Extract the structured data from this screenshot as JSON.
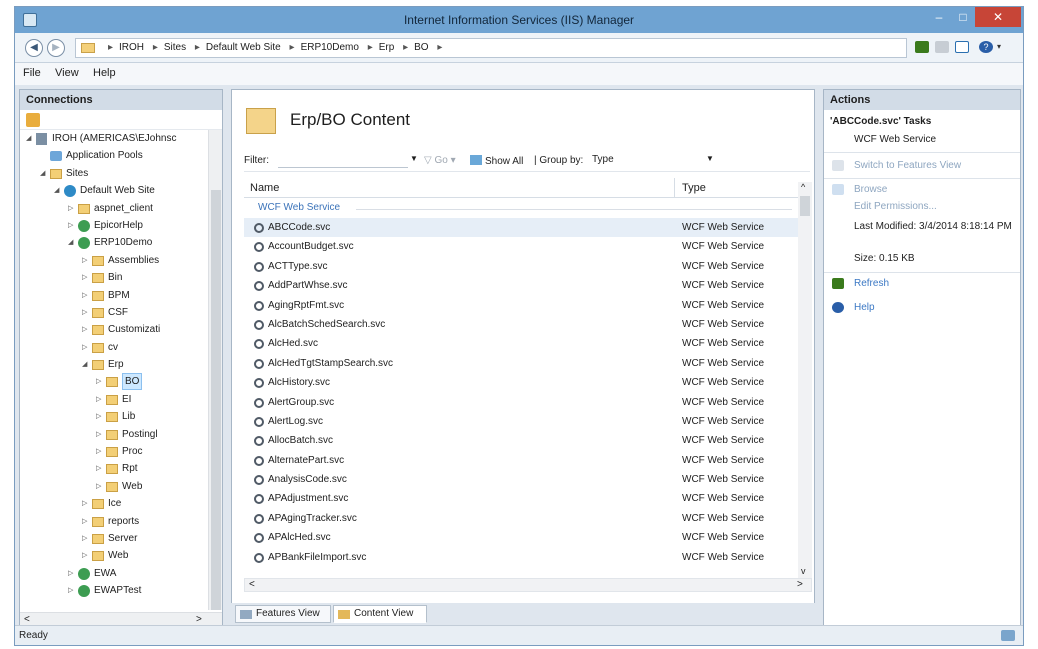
{
  "window": {
    "title": "Internet Information Services (IIS) Manager",
    "min": "–",
    "max": "□",
    "close": "✕"
  },
  "breadcrumb": {
    "items": [
      "IROH",
      "Sites",
      "Default Web Site",
      "ERP10Demo",
      "Erp",
      "BO"
    ]
  },
  "menu": {
    "file": "File",
    "view": "View",
    "help": "Help"
  },
  "connections": {
    "title": "Connections",
    "tree": [
      {
        "label": "IROH (AMERICAS\\EJohnsc",
        "depth": 0,
        "icon": "server",
        "expander": "◢"
      },
      {
        "label": "Application Pools",
        "depth": 1,
        "icon": "pool",
        "expander": ""
      },
      {
        "label": "Sites",
        "depth": 1,
        "icon": "folder",
        "expander": "◢"
      },
      {
        "label": "Default Web Site",
        "depth": 2,
        "icon": "globe",
        "expander": "◢"
      },
      {
        "label": "aspnet_client",
        "depth": 3,
        "icon": "folder",
        "expander": "▷"
      },
      {
        "label": "EpicorHelp",
        "depth": 3,
        "icon": "app",
        "expander": "▷"
      },
      {
        "label": "ERP10Demo",
        "depth": 3,
        "icon": "app",
        "expander": "◢"
      },
      {
        "label": "Assemblies",
        "depth": 4,
        "icon": "folder",
        "expander": "▷"
      },
      {
        "label": "Bin",
        "depth": 4,
        "icon": "folder",
        "expander": "▷"
      },
      {
        "label": "BPM",
        "depth": 4,
        "icon": "folder",
        "expander": "▷"
      },
      {
        "label": "CSF",
        "depth": 4,
        "icon": "folder",
        "expander": "▷"
      },
      {
        "label": "Customizati",
        "depth": 4,
        "icon": "folder",
        "expander": "▷"
      },
      {
        "label": "cv",
        "depth": 4,
        "icon": "folder",
        "expander": "▷"
      },
      {
        "label": "Erp",
        "depth": 4,
        "icon": "folder",
        "expander": "◢"
      },
      {
        "label": "BO",
        "depth": 5,
        "icon": "folder",
        "expander": "▷",
        "selected": true
      },
      {
        "label": "EI",
        "depth": 5,
        "icon": "folder",
        "expander": "▷"
      },
      {
        "label": "Lib",
        "depth": 5,
        "icon": "folder",
        "expander": "▷"
      },
      {
        "label": "Postingl",
        "depth": 5,
        "icon": "folder",
        "expander": "▷"
      },
      {
        "label": "Proc",
        "depth": 5,
        "icon": "folder",
        "expander": "▷"
      },
      {
        "label": "Rpt",
        "depth": 5,
        "icon": "folder",
        "expander": "▷"
      },
      {
        "label": "Web",
        "depth": 5,
        "icon": "folder",
        "expander": "▷"
      },
      {
        "label": "Ice",
        "depth": 4,
        "icon": "folder",
        "expander": "▷"
      },
      {
        "label": "reports",
        "depth": 4,
        "icon": "folder",
        "expander": "▷"
      },
      {
        "label": "Server",
        "depth": 4,
        "icon": "folder",
        "expander": "▷"
      },
      {
        "label": "Web",
        "depth": 4,
        "icon": "folder",
        "expander": "▷"
      },
      {
        "label": "EWA",
        "depth": 3,
        "icon": "app",
        "expander": "▷"
      },
      {
        "label": "EWAPTest",
        "depth": 3,
        "icon": "app",
        "expander": "▷"
      }
    ],
    "scroll_left": "<",
    "scroll_right": ">"
  },
  "main": {
    "title": "Erp/BO Content",
    "filter_label": "Filter:",
    "go": "Go",
    "show_all": "Show All",
    "group_by_label": "| Group by:",
    "group_by_value": "Type",
    "columns": {
      "name": "Name",
      "type": "Type"
    },
    "group_name": "WCF Web Service",
    "rows": [
      {
        "name": "ABCCode.svc",
        "type": "WCF Web Service",
        "selected": true
      },
      {
        "name": "AccountBudget.svc",
        "type": "WCF Web Service"
      },
      {
        "name": "ACTType.svc",
        "type": "WCF Web Service"
      },
      {
        "name": "AddPartWhse.svc",
        "type": "WCF Web Service"
      },
      {
        "name": "AgingRptFmt.svc",
        "type": "WCF Web Service"
      },
      {
        "name": "AlcBatchSchedSearch.svc",
        "type": "WCF Web Service"
      },
      {
        "name": "AlcHed.svc",
        "type": "WCF Web Service"
      },
      {
        "name": "AlcHedTgtStampSearch.svc",
        "type": "WCF Web Service"
      },
      {
        "name": "AlcHistory.svc",
        "type": "WCF Web Service"
      },
      {
        "name": "AlertGroup.svc",
        "type": "WCF Web Service"
      },
      {
        "name": "AlertLog.svc",
        "type": "WCF Web Service"
      },
      {
        "name": "AllocBatch.svc",
        "type": "WCF Web Service"
      },
      {
        "name": "AlternatePart.svc",
        "type": "WCF Web Service"
      },
      {
        "name": "AnalysisCode.svc",
        "type": "WCF Web Service"
      },
      {
        "name": "APAdjustment.svc",
        "type": "WCF Web Service"
      },
      {
        "name": "APAgingTracker.svc",
        "type": "WCF Web Service"
      },
      {
        "name": "APAlcHed.svc",
        "type": "WCF Web Service"
      },
      {
        "name": "APBankFileImport.svc",
        "type": "WCF Web Service"
      }
    ],
    "scroll_up": "^",
    "scroll_down": "v",
    "scroll_left": "<",
    "scroll_right": ">"
  },
  "view_tabs": {
    "features": "Features View",
    "content": "Content View"
  },
  "actions": {
    "title": "Actions",
    "task_title": "'ABCCode.svc' Tasks",
    "task_subtitle": "WCF Web Service",
    "switch_features": "Switch to Features View",
    "browse": "Browse",
    "edit_permissions": "Edit Permissions...",
    "last_modified": "Last Modified: 3/4/2014 8:18:14 PM",
    "size": "Size: 0.15 KB",
    "refresh": "Refresh",
    "help": "Help"
  },
  "status": {
    "text": "Ready"
  },
  "colors": {
    "title_bar": "#6fa3d2",
    "close_button": "#c74537",
    "link": "#3b78c4",
    "selection": "#cde8ff"
  }
}
